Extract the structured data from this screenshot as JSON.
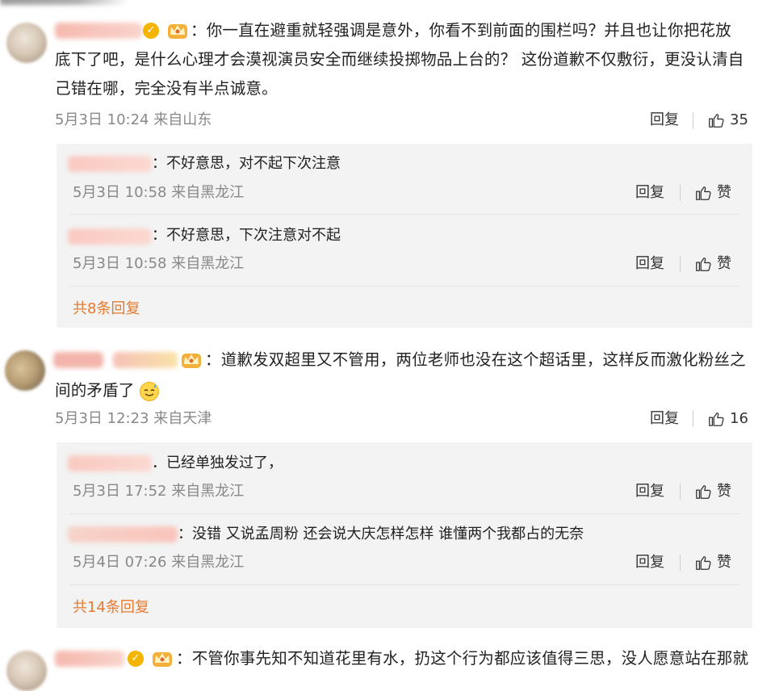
{
  "comments": [
    {
      "text_lines": [
        "：你一直在避重就轻强调是意外，你看不到前面的围栏吗？并且也让你把花放",
        "底下了吧，是什么心理才会漠视演员安全而继续投掷物品上台的？ 这份道歉不仅敷衍，更没认清自",
        "己错在哪，完全没有半点诚意。"
      ],
      "meta": "5月3日 10:24 来自山东",
      "reply_label": "回复",
      "likes": "35",
      "replies": [
        {
          "text": "：不好意思，对不起下次注意",
          "meta": "5月3日 10:58 来自黑龙江",
          "reply_label": "回复",
          "like_label": "赞"
        },
        {
          "text": "：不好意思，下次注意对不起",
          "meta": "5月3日 10:58 来自黑龙江",
          "reply_label": "回复",
          "like_label": "赞"
        }
      ],
      "total_replies": "共8条回复"
    },
    {
      "text_lines": [
        "：道歉发双超里又不管用，两位老师也没在这个超话里，这样反而激化粉丝之",
        "间的矛盾了"
      ],
      "meta": "5月3日 12:23 来自天津",
      "reply_label": "回复",
      "likes": "16",
      "replies": [
        {
          "text": "．已经单独发过了，",
          "meta": "5月3日 17:52 来自黑龙江",
          "reply_label": "回复",
          "like_label": "赞"
        },
        {
          "text": "：没错 又说孟周粉 还会说大庆怎样怎样 谁懂两个我都占的无奈",
          "meta": "5月4日 07:26 来自黑龙江",
          "reply_label": "回复",
          "like_label": "赞"
        }
      ],
      "total_replies": "共14条回复"
    },
    {
      "text_lines": [
        "：不管你事先知不知道花里有水，扔这个行为都应该值得三思，没人愿意站在那就"
      ]
    }
  ],
  "colors": {
    "accent": "#e67a2e",
    "meta": "#888888",
    "sub_bg": "#f3f3f3",
    "badge": "#f5b400"
  }
}
